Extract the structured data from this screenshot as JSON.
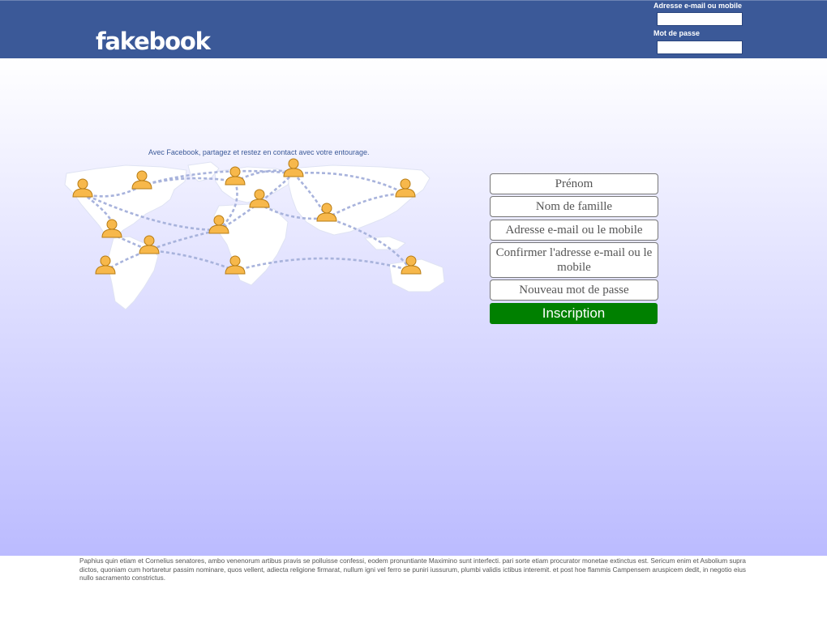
{
  "header": {
    "logo": "fakebook",
    "email_label": "Adresse e-mail ou mobile",
    "password_label": "Mot de passe",
    "email_value": "",
    "password_value": ""
  },
  "main": {
    "tagline": "Avec Facebook, partagez et restez en contact avec votre entourage."
  },
  "signup_form": {
    "first_name": "Prénom",
    "last_name": "Nom de famille",
    "email": "Adresse e-mail ou le mobile",
    "confirm_email": "Confirmer l'adresse e-mail ou le mobile",
    "new_password": "Nouveau mot de passe",
    "submit_label": "Inscription"
  },
  "footer": {
    "text": "Paphius quin etiam et Cornelius senatores, ambo venenorum artibus pravis se polluisse confessi, eodem pronuntiante Maximino sunt interfecti. pari sorte etiam procurator monetae extinctus est. Sericum enim et Asbolium supra dictos, quoniam cum hortaretur passim nominare, quos vellent, adiecta religione firmarat, nullum igni vel ferro se puniri iussurum, plumbi validis ictibus interemit. et post hoe flammis Campensem aruspicem dedit, in negotio eius nullo sacramento constrictus."
  },
  "colors": {
    "brand": "#3b5998",
    "signup_button": "#008000",
    "background_top": "#ffffff",
    "background_bottom": "#bbbbff",
    "person_icon": "#f7b84b"
  }
}
